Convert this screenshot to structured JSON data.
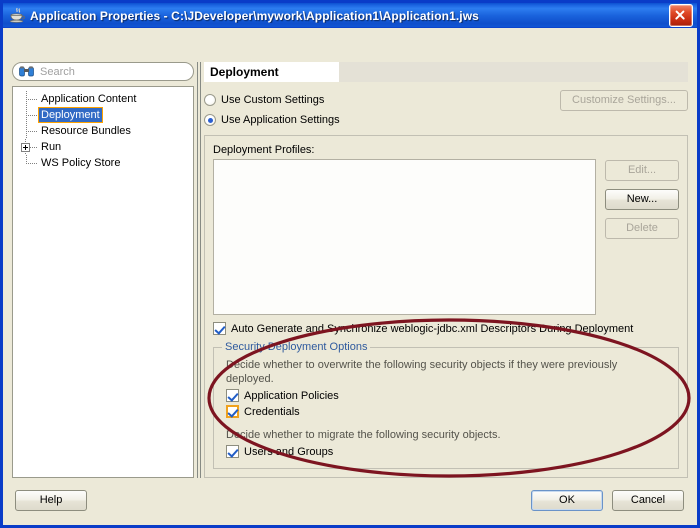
{
  "window": {
    "title": "Application Properties - C:\\JDeveloper\\mywork\\Application1\\Application1.jws",
    "icon": "java-coffee-cup-icon",
    "close_label": "Close"
  },
  "sidebar": {
    "search": {
      "placeholder": "Search",
      "icon": "binoculars-icon",
      "value": ""
    },
    "tree": [
      {
        "label": "Application Content",
        "selected": false,
        "expandable": false
      },
      {
        "label": "Deployment",
        "selected": true,
        "expandable": false
      },
      {
        "label": "Resource Bundles",
        "selected": false,
        "expandable": false
      },
      {
        "label": "Run",
        "selected": false,
        "expandable": true,
        "expander": "plus-icon"
      },
      {
        "label": "WS Policy Store",
        "selected": false,
        "expandable": false
      }
    ]
  },
  "main": {
    "page_title": "Deployment",
    "radios": [
      {
        "label": "Use Custom Settings",
        "checked": false
      },
      {
        "label": "Use Application Settings",
        "checked": true
      }
    ],
    "customize_settings_button": {
      "label": "Customize Settings...",
      "enabled": false
    },
    "profiles": {
      "label": "Deployment Profiles:",
      "items": [],
      "buttons": [
        {
          "label": "Edit...",
          "enabled": false
        },
        {
          "label": "New...",
          "enabled": true
        },
        {
          "label": "Delete",
          "enabled": false
        }
      ]
    },
    "auto_generate_checkbox": {
      "label": "Auto Generate and Synchronize weblogic-jdbc.xml Descriptors During Deployment",
      "checked": true,
      "focused": false
    },
    "security_group": {
      "legend": "Security Deployment Options",
      "legend_color": "#2f5a9e",
      "description_overwrite": "Decide whether to overwrite the following security objects if they were previously deployed.",
      "description_migrate": "Decide whether to migrate the following security objects.",
      "checkboxes_overwrite": [
        {
          "label": "Application Policies",
          "checked": true,
          "focused": false
        },
        {
          "label": "Credentials",
          "checked": true,
          "focused": true
        }
      ],
      "checkboxes_migrate": [
        {
          "label": "Users and Groups",
          "checked": true,
          "focused": false
        }
      ]
    }
  },
  "footer": {
    "help_label": "Help",
    "ok_label": "OK",
    "cancel_label": "Cancel"
  },
  "annotation": {
    "shape": "ellipse-highlight",
    "color": "#7d1420"
  },
  "colors": {
    "title_bar": "#1a63e0",
    "dialog_face": "#ece9d8",
    "selection": "#316ac5",
    "focus_orange": "#ffa300",
    "annotation_maroon": "#7d1420"
  }
}
